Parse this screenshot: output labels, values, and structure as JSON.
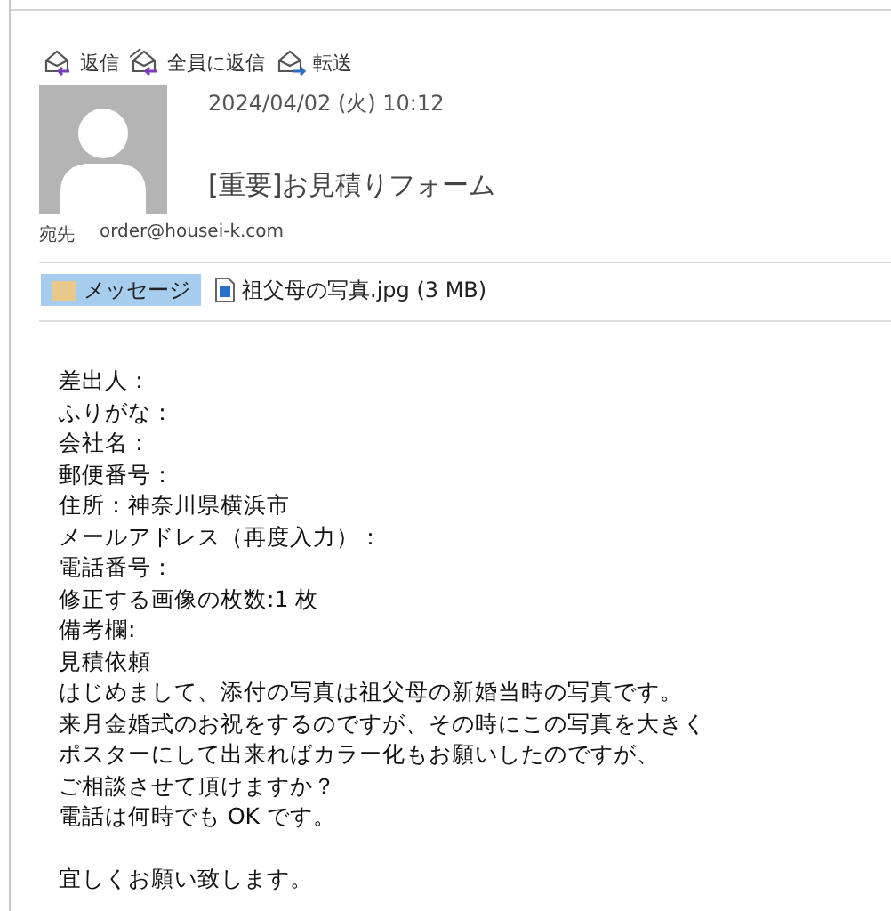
{
  "actions": [
    {
      "kind": "reply",
      "label": "返信"
    },
    {
      "kind": "reply_all",
      "label": "全員に返信"
    },
    {
      "kind": "forward",
      "label": "転送"
    }
  ],
  "message": {
    "date": "2024/04/02 (火) 10:12",
    "subject": "[重要]お見積りフォーム",
    "to_label": "宛先",
    "to": "order@housei-k.com"
  },
  "attachments": [
    {
      "kind": "message",
      "label": "メッセージ",
      "selected": true
    },
    {
      "kind": "image",
      "label": "祖父母の写真.jpg (3 MB)",
      "selected": false
    }
  ],
  "body": [
    [
      "差出人：",
      "ふりがな：",
      "会社名：",
      "郵便番号：",
      "住所：神奈川県横浜市",
      "メールアドレス（再度入力）：",
      "電話番号：",
      "修正する画像の枚数:1 枚",
      "備考欄:",
      "見積依頼",
      "はじめまして、添付の写真は祖父母の新婚当時の写真です。",
      "来月金婚式のお祝をするのですが、その時にこの写真を大きく",
      "ポスターにして出来ればカラー化もお願いしたのですが、",
      "ご相談させて頂けますか？",
      "電話は何時でも OK です。"
    ],
    [
      "宜しくお願い致します。"
    ]
  ]
}
